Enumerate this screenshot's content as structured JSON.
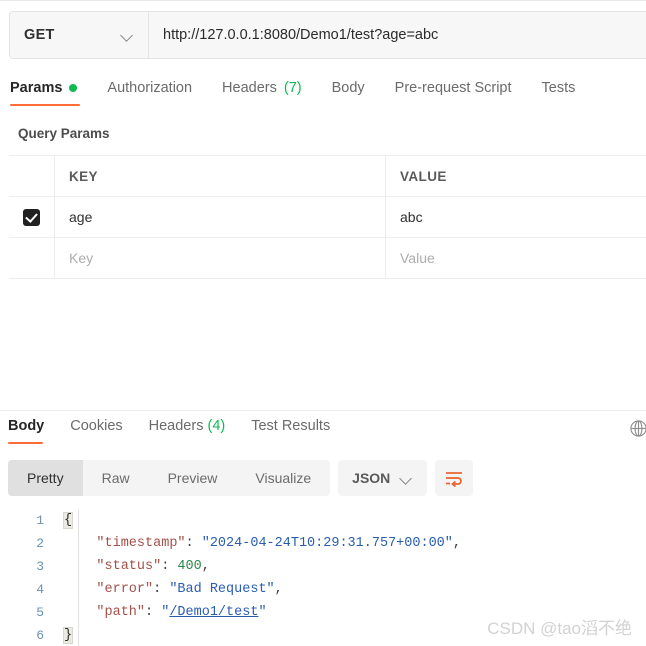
{
  "request": {
    "method": "GET",
    "url": "http://127.0.0.1:8080/Demo1/test?age=abc",
    "tabs": [
      {
        "label": "Params",
        "badge_dot": true,
        "active": true
      },
      {
        "label": "Authorization",
        "active": false
      },
      {
        "label": "Headers",
        "count": "(7)",
        "active": false
      },
      {
        "label": "Body",
        "active": false
      },
      {
        "label": "Pre-request Script",
        "active": false
      },
      {
        "label": "Tests",
        "active": false
      }
    ]
  },
  "query_params": {
    "section_title": "Query Params",
    "columns": [
      "KEY",
      "VALUE"
    ],
    "rows": [
      {
        "checked": true,
        "key": "age",
        "value": "abc"
      }
    ],
    "placeholder_row": {
      "key": "Key",
      "value": "Value"
    }
  },
  "response": {
    "tabs": [
      {
        "label": "Body",
        "active": true
      },
      {
        "label": "Cookies",
        "active": false
      },
      {
        "label": "Headers",
        "count": "(4)",
        "active": false
      },
      {
        "label": "Test Results",
        "active": false
      }
    ],
    "views": [
      {
        "label": "Pretty",
        "active": true
      },
      {
        "label": "Raw",
        "active": false
      },
      {
        "label": "Preview",
        "active": false
      },
      {
        "label": "Visualize",
        "active": false
      }
    ],
    "format": "JSON",
    "body_lines": [
      {
        "no": "1",
        "tokens": [
          {
            "t": "{",
            "c": "brace"
          }
        ]
      },
      {
        "no": "2",
        "tokens": [
          {
            "t": "    ",
            "c": "p"
          },
          {
            "t": "\"timestamp\"",
            "c": "k"
          },
          {
            "t": ": ",
            "c": "p"
          },
          {
            "t": "\"2024-04-24T10:29:31.757+00:00\"",
            "c": "s"
          },
          {
            "t": ",",
            "c": "p"
          }
        ]
      },
      {
        "no": "3",
        "tokens": [
          {
            "t": "    ",
            "c": "p"
          },
          {
            "t": "\"status\"",
            "c": "k"
          },
          {
            "t": ": ",
            "c": "p"
          },
          {
            "t": "400",
            "c": "n"
          },
          {
            "t": ",",
            "c": "p"
          }
        ]
      },
      {
        "no": "4",
        "tokens": [
          {
            "t": "    ",
            "c": "p"
          },
          {
            "t": "\"error\"",
            "c": "k"
          },
          {
            "t": ": ",
            "c": "p"
          },
          {
            "t": "\"Bad Request\"",
            "c": "s"
          },
          {
            "t": ",",
            "c": "p"
          }
        ]
      },
      {
        "no": "5",
        "tokens": [
          {
            "t": "    ",
            "c": "p"
          },
          {
            "t": "\"path\"",
            "c": "k"
          },
          {
            "t": ": ",
            "c": "p"
          },
          {
            "t": "\"",
            "c": "s"
          },
          {
            "t": "/Demo1/test",
            "c": "lnk"
          },
          {
            "t": "\"",
            "c": "s"
          }
        ]
      },
      {
        "no": "6",
        "tokens": [
          {
            "t": "}",
            "c": "brace"
          }
        ]
      }
    ],
    "json_values": {
      "timestamp": "2024-04-24T10:29:31.757+00:00",
      "status": 400,
      "error": "Bad Request",
      "path": "/Demo1/test"
    }
  },
  "watermark": "CSDN @tao滔不绝",
  "colors": {
    "accent": "#ff6c37",
    "green": "#0cbb52",
    "json_key": "#a3514a",
    "json_string": "#2a5db0",
    "json_number": "#2c8a4b"
  }
}
